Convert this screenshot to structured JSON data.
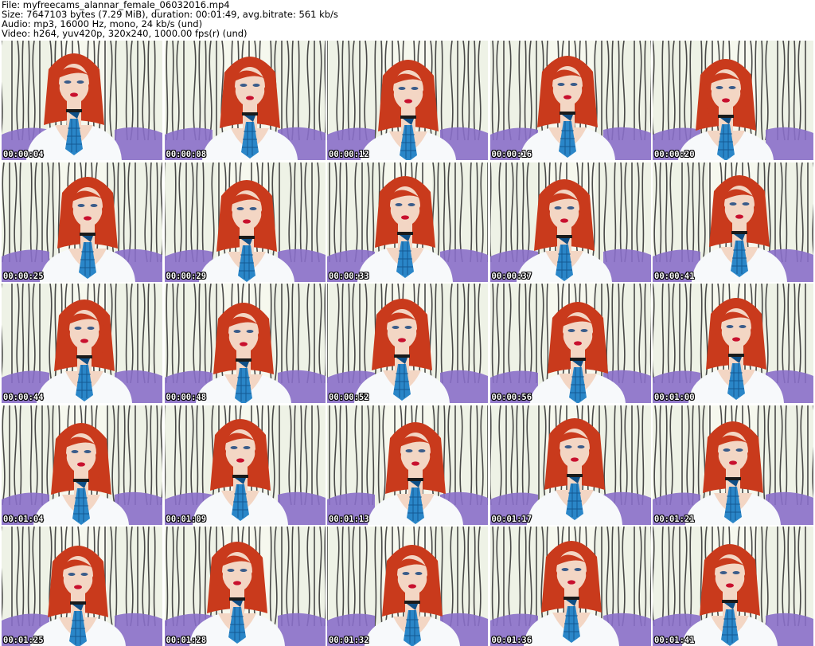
{
  "header": {
    "file_line": "File: myfreecams_alannar_female_06032016.mp4",
    "size_line": "Size: 7647103 bytes (7.29 MiB), duration: 00:01:49, avg.bitrate: 561 kb/s",
    "audio_line": "Audio: mp3, 16000 Hz, mono, 24 kb/s (und)",
    "video_line": "Video: h264, yuv420p, 320x240, 1000.00 fps(r) (und)"
  },
  "thumbnails": [
    {
      "timestamp": "00:00:04"
    },
    {
      "timestamp": "00:00:08"
    },
    {
      "timestamp": "00:00:12"
    },
    {
      "timestamp": "00:00:16"
    },
    {
      "timestamp": "00:00:20"
    },
    {
      "timestamp": "00:00:25"
    },
    {
      "timestamp": "00:00:29"
    },
    {
      "timestamp": "00:00:33"
    },
    {
      "timestamp": "00:00:37"
    },
    {
      "timestamp": "00:00:41"
    },
    {
      "timestamp": "00:00:44"
    },
    {
      "timestamp": "00:00:48"
    },
    {
      "timestamp": "00:00:52"
    },
    {
      "timestamp": "00:00:56"
    },
    {
      "timestamp": "00:01:00"
    },
    {
      "timestamp": "00:01:04"
    },
    {
      "timestamp": "00:01:09"
    },
    {
      "timestamp": "00:01:13"
    },
    {
      "timestamp": "00:01:17"
    },
    {
      "timestamp": "00:01:21"
    },
    {
      "timestamp": "00:01:25"
    },
    {
      "timestamp": "00:01:28"
    },
    {
      "timestamp": "00:01:32"
    },
    {
      "timestamp": "00:01:36"
    },
    {
      "timestamp": "00:01:41"
    }
  ],
  "colors": {
    "hair": "#c93a1c",
    "skin": "#f3d6c4",
    "blouse": "#f7f9fb",
    "tie": "#2a86c8",
    "tie_dark": "#0f4f86",
    "lips": "#c8102e",
    "curtain": "#2b2b2b",
    "wall": "#eef2e6",
    "sofa": "#8a6fc9"
  }
}
